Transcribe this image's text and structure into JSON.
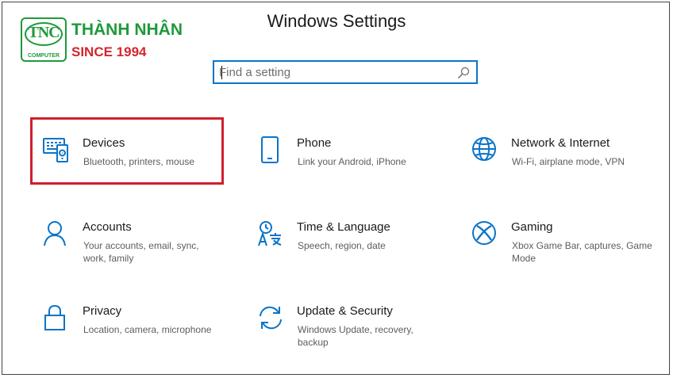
{
  "window": {
    "title": "Windows Settings"
  },
  "watermark": {
    "logo_text": "TNC",
    "logo_sub": "COMPUTER",
    "name": "THÀNH NHÂN",
    "since": "SINCE 1994",
    "colors": {
      "green": "#1e9a3a",
      "red": "#d3262e"
    }
  },
  "search": {
    "placeholder": "Find a setting",
    "value": "",
    "icon": "search-icon"
  },
  "accent_color": "#0a74c8",
  "highlight_color": "#d11f2c",
  "categories": [
    {
      "id": "devices",
      "icon": "devices-icon",
      "name": "Devices",
      "desc": "Bluetooth, printers, mouse",
      "highlighted": true
    },
    {
      "id": "phone",
      "icon": "phone-icon",
      "name": "Phone",
      "desc": "Link your Android, iPhone"
    },
    {
      "id": "network",
      "icon": "globe-icon",
      "name": "Network & Internet",
      "desc": "Wi-Fi, airplane mode, VPN"
    },
    {
      "id": "accounts",
      "icon": "person-icon",
      "name": "Accounts",
      "desc": "Your accounts, email, sync, work, family"
    },
    {
      "id": "time",
      "icon": "time-language-icon",
      "name": "Time & Language",
      "desc": "Speech, region, date"
    },
    {
      "id": "gaming",
      "icon": "xbox-icon",
      "name": "Gaming",
      "desc": "Xbox Game Bar, captures, Game Mode"
    },
    {
      "id": "privacy",
      "icon": "lock-icon",
      "name": "Privacy",
      "desc": "Location, camera, microphone"
    },
    {
      "id": "update",
      "icon": "sync-icon",
      "name": "Update & Security",
      "desc": "Windows Update, recovery, backup"
    }
  ]
}
